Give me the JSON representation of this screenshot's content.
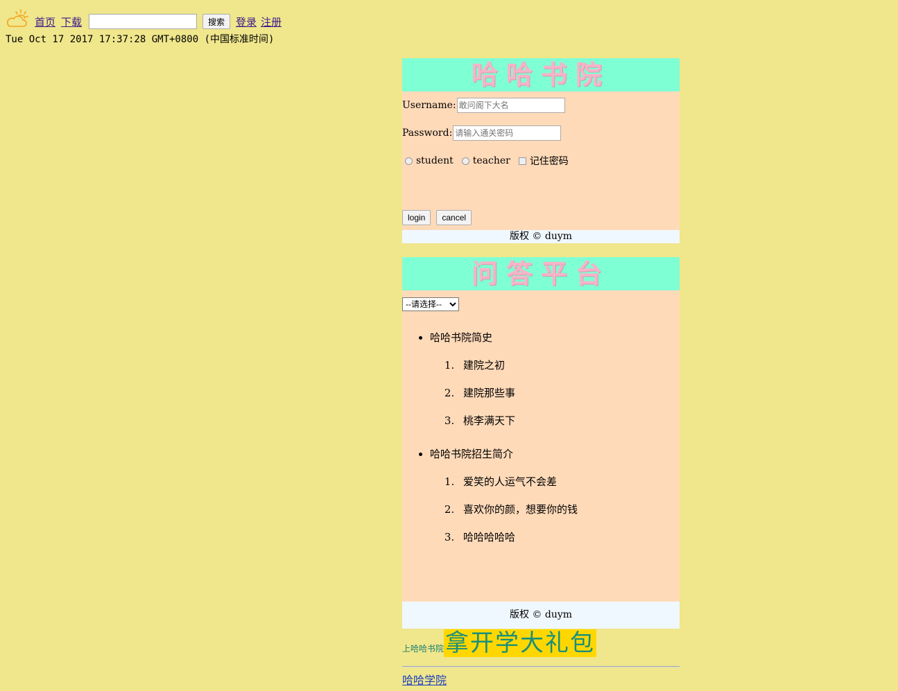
{
  "topbar": {
    "icon": "weather-partly-cloudy-icon",
    "nav_home": "首页",
    "nav_download": "下载",
    "search_placeholder": "",
    "search_button": "搜索",
    "login_link": "登录",
    "register_link": "注册"
  },
  "datetime": "Tue Oct 17 2017 17:37:28 GMT+0800 (中国标准时间)",
  "login_panel": {
    "banner": "哈哈书院",
    "username_label": "Username:",
    "username_placeholder": "敢问阁下大名",
    "password_label": "Password:",
    "password_placeholder": "请输入通关密码",
    "role_student": "student",
    "role_teacher": "teacher",
    "remember": "记住密码",
    "login_button": "login",
    "cancel_button": "cancel",
    "footer": "版权 © duym"
  },
  "qa_panel": {
    "banner": "问答平台",
    "select_value": "--请选择--",
    "sections": [
      {
        "title": "哈哈书院简史",
        "items": [
          "建院之初",
          "建院那些事",
          "桃李满天下"
        ]
      },
      {
        "title": "哈哈书院招生简介",
        "items": [
          "爱笑的人运气不会差",
          "喜欢你的颜，想要你的钱",
          "哈哈哈哈哈"
        ]
      }
    ],
    "footer": "版权 © duym"
  },
  "promo": {
    "small_text": "上哈哈书院",
    "big_text": "拿开学大礼包"
  },
  "bottom_link": "哈哈学院",
  "colors": {
    "page_bg": "#f0e68c",
    "banner_bg": "#7fffd4",
    "panel_bg": "#ffdab9",
    "footer_bg": "#f0f8ff",
    "promo_bg": "#ffd700"
  }
}
